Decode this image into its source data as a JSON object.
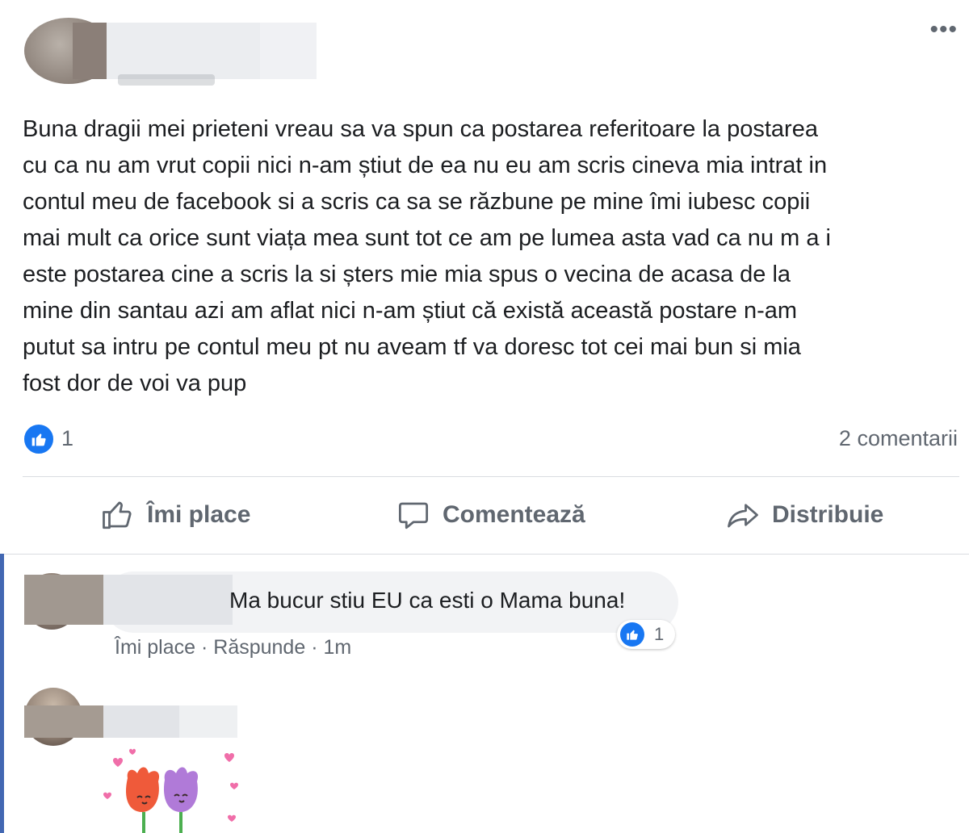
{
  "post": {
    "menu_label": "•••",
    "text": "Buna dragii mei prieteni vreau sa va spun ca postarea referitoare la postarea\ncu ca nu am vrut copii nici n-am știut de ea nu eu am scris cineva mia intrat in\ncontul meu de facebook si a scris ca sa se răzbune pe mine îmi iubesc copii\nmai mult ca orice sunt viața mea sunt tot ce am pe lumea asta vad ca nu m a i\neste postarea cine a scris la si șters mie mia spus o vecina de acasa de la\nmine din santau azi am aflat nici n-am știut că există această postare n-am\nputut sa intru pe contul meu pt nu aveam tf va doresc tot cei mai bun si mia\nfost dor de voi va pup",
    "reaction_count": "1",
    "comments_count": "2 comentarii"
  },
  "actions": {
    "like": "Îmi place",
    "comment": "Comentează",
    "share": "Distribuie"
  },
  "comments": [
    {
      "text": "Ma bucur stiu EU ca esti o Mama buna!",
      "like_count": "1",
      "like_label": "Îmi place",
      "separator": " · ",
      "reply_label": "Răspunde",
      "time": "1m"
    }
  ],
  "colors": {
    "facebook_blue": "#1877f2",
    "thread_bar": "#4267b2",
    "secondary_text": "#606770"
  },
  "icons": [
    "more-icon",
    "like-reaction-icon",
    "thumbs-up-icon",
    "comment-icon",
    "share-icon",
    "tulip-sticker"
  ]
}
